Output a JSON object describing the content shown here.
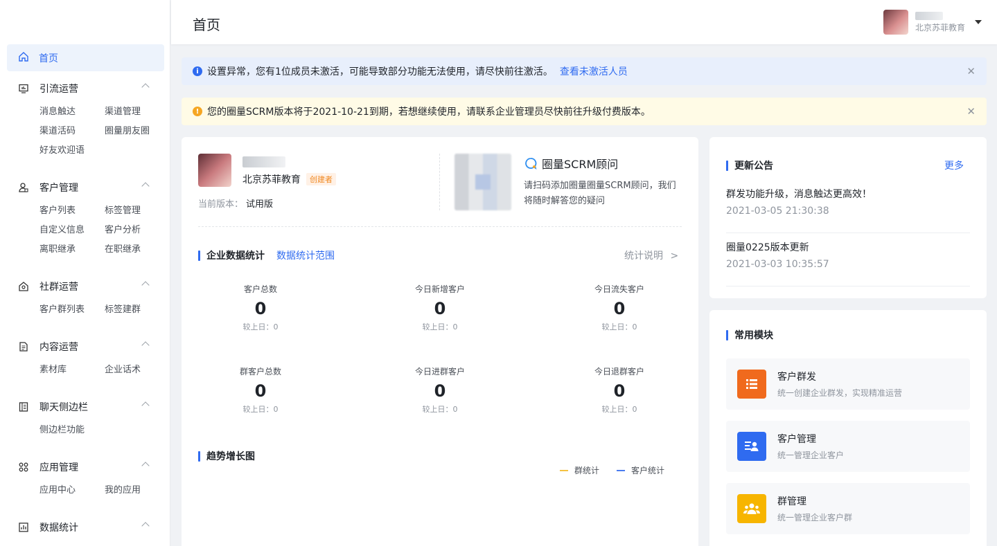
{
  "topbar": {
    "title": "首页",
    "user_org": "北京苏菲教育"
  },
  "sidebar": {
    "home": "首页",
    "sections": [
      {
        "title": "引流运营",
        "icon": "monitor-icon",
        "items": [
          "消息触达",
          "渠道管理",
          "渠道活码",
          "圈量朋友圈",
          "好友欢迎语"
        ]
      },
      {
        "title": "客户管理",
        "icon": "user-icon",
        "items": [
          "客户列表",
          "标签管理",
          "自定义信息",
          "客户分析",
          "离职继承",
          "在职继承"
        ]
      },
      {
        "title": "社群运营",
        "icon": "house-icon",
        "items": [
          "客户群列表",
          "标签建群"
        ]
      },
      {
        "title": "内容运营",
        "icon": "document-icon",
        "items": [
          "素材库",
          "企业话术"
        ]
      },
      {
        "title": "聊天侧边栏",
        "icon": "sidebar-icon",
        "items": [
          "侧边栏功能"
        ]
      },
      {
        "title": "应用管理",
        "icon": "apps-icon",
        "items": [
          "应用中心",
          "我的应用"
        ]
      },
      {
        "title": "数据统计",
        "icon": "chart-icon",
        "items": []
      }
    ]
  },
  "alerts": {
    "info_text": "设置异常，您有1位成员未激活，可能导致部分功能无法使用，请尽快前往激活。",
    "info_link": "查看未激活人员",
    "warn_text": "您的圈量SCRM版本将于2021-10-21到期，若想继续使用，请联系企业管理员尽快前往升级付费版本。"
  },
  "profile": {
    "org": "北京苏菲教育",
    "badge": "创建者",
    "version_label": "当前版本：",
    "version_value": "试用版"
  },
  "advisor": {
    "title": "圈量SCRM顾问",
    "desc": "请扫码添加圈量圈量SCRM顾问，我们将随时解答您的疑问"
  },
  "stats": {
    "title": "企业数据统计",
    "range_link": "数据统计范围",
    "help": "统计说明",
    "items": [
      {
        "label": "客户总数",
        "value": "0",
        "compare": "较上日：0"
      },
      {
        "label": "今日新增客户",
        "value": "0",
        "compare": "较上日：0"
      },
      {
        "label": "今日流失客户",
        "value": "0",
        "compare": "较上日：0"
      },
      {
        "label": "群客户总数",
        "value": "0",
        "compare": "较上日：0"
      },
      {
        "label": "今日进群客户",
        "value": "0",
        "compare": "较上日：0"
      },
      {
        "label": "今日退群客户",
        "value": "0",
        "compare": "较上日：0"
      }
    ]
  },
  "trend": {
    "title": "趋势增长图",
    "legend": [
      {
        "name": "群统计",
        "color": "#f5c242"
      },
      {
        "name": "客户统计",
        "color": "#4a7cf0"
      }
    ]
  },
  "notices": {
    "title": "更新公告",
    "more": "更多",
    "items": [
      {
        "title": "群发功能升级，消息触达更高效！",
        "date": "2021-03-05 21:30:38"
      },
      {
        "title": "圈量0225版本更新",
        "date": "2021-03-03 10:35:57"
      }
    ]
  },
  "modules": {
    "title": "常用模块",
    "items": [
      {
        "name": "客户群发",
        "desc": "统一创建企业群发，实现精准运营",
        "color": "#f06a1d",
        "icon": "list-icon"
      },
      {
        "name": "客户管理",
        "desc": "统一管理企业客户",
        "color": "#2f6bf0",
        "icon": "contact-card-icon"
      },
      {
        "name": "群管理",
        "desc": "统一管理企业客户群",
        "color": "#f7b500",
        "icon": "group-icon"
      }
    ]
  }
}
